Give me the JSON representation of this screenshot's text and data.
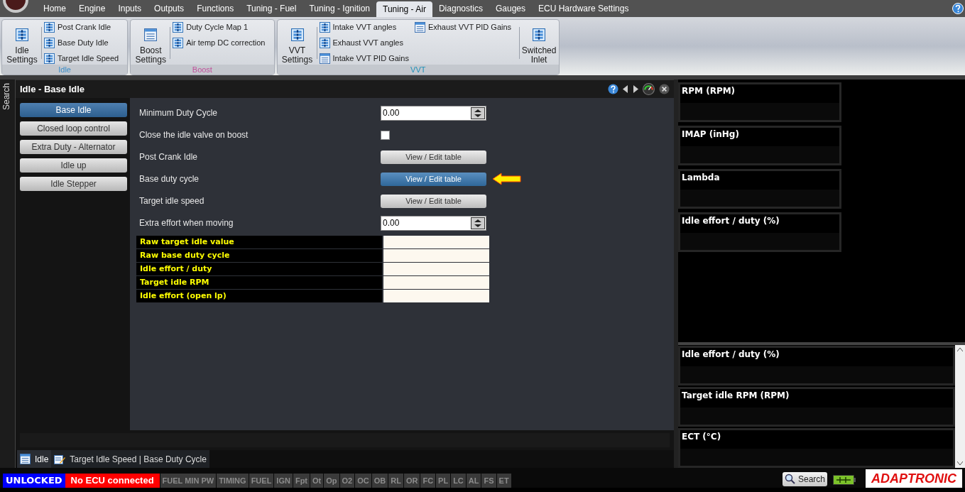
{
  "top_tabs": [
    {
      "label": "Home",
      "selected": false
    },
    {
      "label": "Engine",
      "selected": false
    },
    {
      "label": "Inputs",
      "selected": false
    },
    {
      "label": "Outputs",
      "selected": false
    },
    {
      "label": "Functions",
      "selected": false
    },
    {
      "label": "Tuning - Fuel",
      "selected": false
    },
    {
      "label": "Tuning - Ignition",
      "selected": false
    },
    {
      "label": "Tuning - Air",
      "selected": true
    },
    {
      "label": "Diagnostics",
      "selected": false
    },
    {
      "label": "Gauges",
      "selected": false
    },
    {
      "label": "ECU Hardware Settings",
      "selected": false
    }
  ],
  "ribbon_groups": [
    {
      "label": "Idle",
      "color": "#3a8cc8",
      "parts": [
        {
          "kind": "big_table",
          "label": "Idle Settings"
        },
        {
          "kind": "column",
          "items": [
            {
              "kind": "table",
              "label": "Post Crank Idle"
            },
            {
              "kind": "table",
              "label": "Base Duty Idle"
            },
            {
              "kind": "table",
              "label": "Target Idle Speed"
            }
          ]
        }
      ]
    },
    {
      "label": "Boost",
      "color": "#c0509a",
      "parts": [
        {
          "kind": "big_list",
          "label": "Boost Settings"
        },
        {
          "kind": "column",
          "items": [
            {
              "kind": "table",
              "label": "Duty Cycle Map 1"
            },
            {
              "kind": "table",
              "label": "Air temp DC correction"
            }
          ]
        }
      ]
    },
    {
      "label": "VVT",
      "color": "#1e90b8",
      "parts": [
        {
          "kind": "big_table",
          "label": "VVT Settings"
        },
        {
          "kind": "column",
          "items": [
            {
              "kind": "table",
              "label": "Intake VVT angles"
            },
            {
              "kind": "table",
              "label": "Exhaust VVT angles"
            },
            {
              "kind": "list",
              "label": "Intake VVT PID Gains"
            }
          ]
        },
        {
          "kind": "column",
          "items": [
            {
              "kind": "list",
              "label": "Exhaust VVT PID Gains"
            }
          ]
        },
        {
          "kind": "big_table",
          "label": "Switched Inlet"
        }
      ]
    }
  ],
  "side_tab": "Search",
  "panel": {
    "title": "Idle - Base Idle",
    "nav": [
      {
        "label": "Base Idle",
        "selected": true
      },
      {
        "label": "Closed loop control",
        "selected": false
      },
      {
        "label": "Extra Duty - Alternator",
        "selected": false
      },
      {
        "label": "Idle up",
        "selected": false
      },
      {
        "label": "Idle Stepper",
        "selected": false
      }
    ],
    "settings": [
      {
        "kind": "number",
        "label": "Minimum Duty Cycle",
        "value": "0.00"
      },
      {
        "kind": "checkbox",
        "label": "Close the idle valve on boost",
        "checked": false
      },
      {
        "kind": "button",
        "label": "Post Crank Idle",
        "button": "View / Edit table",
        "highlighted": false,
        "pointer": false
      },
      {
        "kind": "button",
        "label": "Base duty cycle",
        "button": "View / Edit table",
        "highlighted": true,
        "pointer": true
      },
      {
        "kind": "button",
        "label": "Target idle speed",
        "button": "View / Edit table",
        "highlighted": false,
        "pointer": false
      },
      {
        "kind": "number",
        "label": "Extra effort when moving",
        "value": "0.00"
      }
    ],
    "readouts": [
      "Raw target idle value",
      "Raw base duty cycle",
      "Idle effort / duty",
      "Target idle RPM",
      "Idle effort (open lp)"
    ]
  },
  "doc_tabs": [
    {
      "kind": "list",
      "label": "Idle",
      "selected": true
    },
    {
      "kind": "edit",
      "label": "Target Idle Speed | Base Duty Cycle",
      "selected": false
    }
  ],
  "gauges_top": [
    "RPM (RPM)",
    "IMAP  (inHg)",
    "Lambda",
    "Idle effort / duty (%)"
  ],
  "gauges_bottom": [
    "Idle effort / duty (%)",
    "Target idle RPM (RPM)",
    "ECT (°C)"
  ],
  "status_bar": {
    "lock": "UNLOCKED",
    "connection": "No ECU connected",
    "flags": [
      "FUEL MIN PW",
      "TIMING",
      "FUEL",
      "IGN",
      "Fpt",
      "Ot",
      "Op",
      "O2",
      "OC",
      "OB",
      "RL",
      "OR",
      "FC",
      "PL",
      "LC",
      "AL",
      "FS",
      "ET"
    ],
    "search": "Search",
    "logo": "ADAPTRONIC"
  }
}
